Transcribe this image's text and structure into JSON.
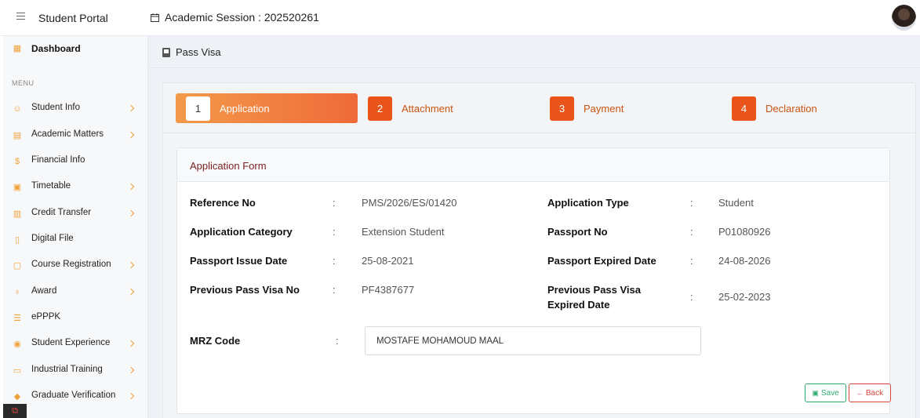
{
  "topbar": {
    "brand": "Student Portal",
    "session": "Academic Session : 202520261"
  },
  "sidebar": {
    "dashboard": "Dashboard",
    "menu_title": "MENU",
    "items": [
      {
        "label": "Student Info",
        "icon": "user-icon",
        "chevron": true
      },
      {
        "label": "Academic Matters",
        "icon": "layout-icon",
        "chevron": true
      },
      {
        "label": "Financial Info",
        "icon": "dollar-icon",
        "chevron": false
      },
      {
        "label": "Timetable",
        "icon": "calendar-icon",
        "chevron": true
      },
      {
        "label": "Credit Transfer",
        "icon": "file-icon",
        "chevron": true
      },
      {
        "label": "Digital File",
        "icon": "file-icon",
        "chevron": false
      },
      {
        "label": "Course Registration",
        "icon": "clipboard-icon",
        "chevron": true
      },
      {
        "label": "Award",
        "icon": "award-icon",
        "chevron": true
      },
      {
        "label": "ePPPK",
        "icon": "list-icon",
        "chevron": false
      },
      {
        "label": "Student Experience",
        "icon": "globe-icon",
        "chevron": true
      },
      {
        "label": "Industrial Training",
        "icon": "monitor-icon",
        "chevron": true
      },
      {
        "label": "Graduate Verification",
        "icon": "gem-icon",
        "chevron": true
      }
    ]
  },
  "breadcrumb": "Pass Visa",
  "steps": [
    {
      "num": "1",
      "label": "Application"
    },
    {
      "num": "2",
      "label": "Attachment"
    },
    {
      "num": "3",
      "label": "Payment"
    },
    {
      "num": "4",
      "label": "Declaration"
    }
  ],
  "form": {
    "title": "Application Form",
    "fields": {
      "reference_no": {
        "label": "Reference No",
        "value": "PMS/2026/ES/01420"
      },
      "application_type": {
        "label": "Application Type",
        "value": "Student"
      },
      "application_category": {
        "label": "Application Category",
        "value": "Extension Student"
      },
      "passport_no": {
        "label": "Passport No",
        "value": "P01080926"
      },
      "passport_issue_date": {
        "label": "Passport Issue Date",
        "value": "25-08-2021"
      },
      "passport_expired_date": {
        "label": "Passport Expired Date",
        "value": "24-08-2026"
      },
      "prev_pass_visa_no": {
        "label": "Previous Pass Visa No",
        "value": "PF4387677"
      },
      "prev_pass_visa_expired": {
        "label": "Previous Pass Visa Expired Date",
        "value": "25-02-2023"
      }
    },
    "mrz": {
      "label": "MRZ Code",
      "value": "MOSTAFE MOHAMOUD MAAL"
    },
    "colon": ":",
    "save_label": "Save",
    "back_label": "Back"
  },
  "colors": {
    "accent": "#e8541a",
    "sidebar_icon": "#f0a23a",
    "save": "#2eaa6d",
    "back": "#d9463a"
  }
}
